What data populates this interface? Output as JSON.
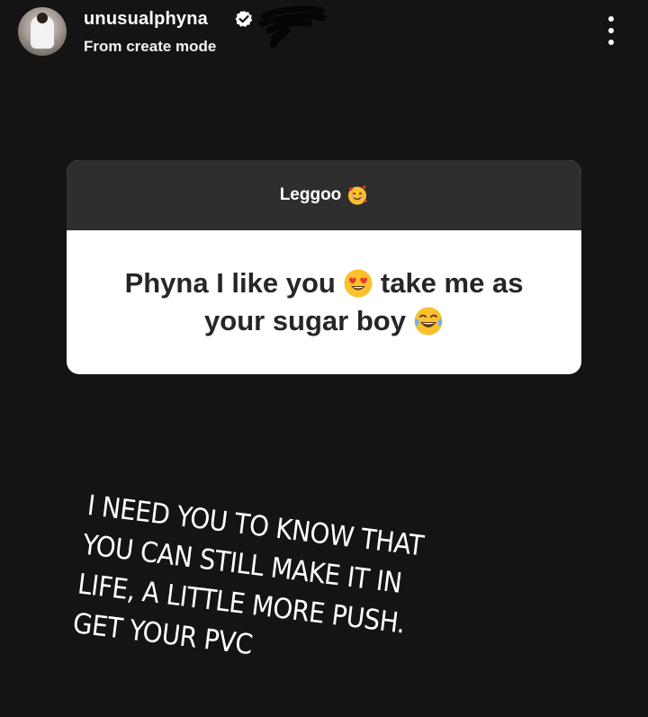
{
  "header": {
    "username": "unusualphyna",
    "subtitle": "From create mode",
    "avatar_icon": "profile-photo",
    "verified_icon": "verified-badge-icon",
    "more_icon": "more-vertical-icon"
  },
  "question_card": {
    "title": "Leggoo",
    "title_emoji": "smiling-face-with-hearts",
    "line1": "Phyna I like you",
    "line1_emoji": "heart-eyes",
    "line1_tail": "take me as",
    "line2": "your sugar boy",
    "line2_emoji": "tears-of-joy"
  },
  "response_text": {
    "lines": [
      "I NEED YOU TO KNOW THAT",
      "YOU CAN STILL MAKE IT IN",
      "LIFE, A LITTLE MORE PUSH.",
      "GET YOUR PVC"
    ]
  },
  "colors": {
    "background": "#141414",
    "card_header": "#2e2e2e",
    "card_body": "#ffffff",
    "question_text": "#262626"
  }
}
